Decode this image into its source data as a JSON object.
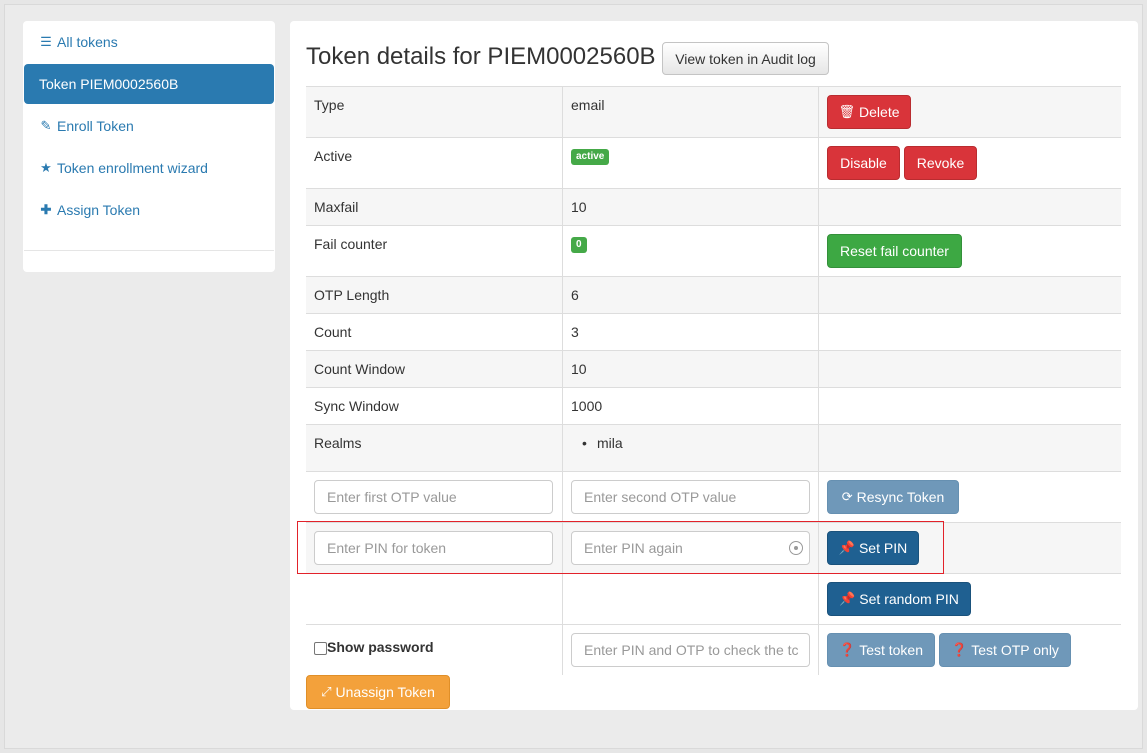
{
  "sidebar": {
    "items": [
      {
        "label": "All tokens",
        "icon": "list-icon"
      },
      {
        "label": "Token PIEM0002560B",
        "icon": ""
      },
      {
        "label": "Enroll Token",
        "icon": "edit-icon"
      },
      {
        "label": "Token enrollment wizard",
        "icon": "star-icon"
      },
      {
        "label": "Assign Token",
        "icon": "plus-icon"
      }
    ]
  },
  "main": {
    "title": "Token details for PIEM0002560B",
    "audit_button": "View token in Audit log",
    "rows": {
      "type": {
        "label": "Type",
        "value": "email"
      },
      "active": {
        "label": "Active",
        "value": "active"
      },
      "maxfail": {
        "label": "Maxfail",
        "value": "10"
      },
      "failcounter": {
        "label": "Fail counter",
        "value": "0"
      },
      "otplen": {
        "label": "OTP Length",
        "value": "6"
      },
      "count": {
        "label": "Count",
        "value": "3"
      },
      "countwindow": {
        "label": "Count Window",
        "value": "10"
      },
      "syncwindow": {
        "label": "Sync Window",
        "value": "1000"
      },
      "realms": {
        "label": "Realms",
        "value": "mila"
      }
    },
    "buttons": {
      "delete": "Delete",
      "disable": "Disable",
      "revoke": "Revoke",
      "reset_fail": "Reset fail counter",
      "resync": "Resync Token",
      "set_pin": "Set PIN",
      "set_random_pin": "Set random PIN",
      "test_token": "Test token",
      "test_otp_only": "Test OTP only",
      "unassign": "Unassign Token"
    },
    "inputs": {
      "otp1_placeholder": "Enter first OTP value",
      "otp2_placeholder": "Enter second OTP value",
      "pin1_placeholder": "Enter PIN for token",
      "pin2_placeholder": "Enter PIN again",
      "check_placeholder": "Enter PIN and OTP to check the tc"
    },
    "show_password": "Show password"
  },
  "colors": {
    "accent": "#2a7ab0",
    "danger": "#d9343a",
    "success": "#3da843",
    "highlight": "#e2222a"
  }
}
